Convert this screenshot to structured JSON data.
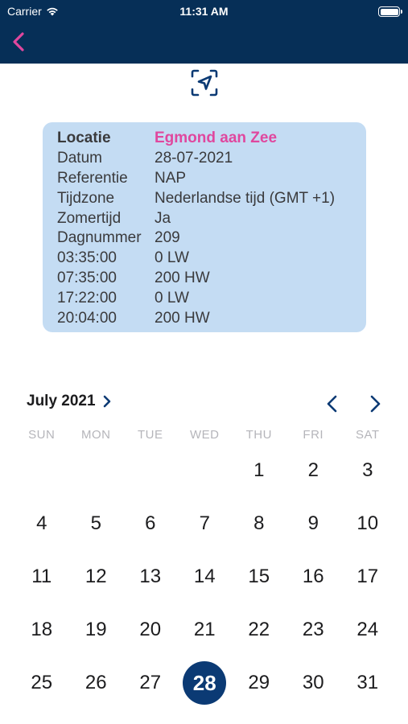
{
  "status": {
    "carrier": "Carrier",
    "time": "11:31 AM"
  },
  "nav": {
    "back_icon": "chevron-left-icon",
    "locate_icon": "location-arrow-icon"
  },
  "colors": {
    "header": "#062f57",
    "card": "#c4dcf3",
    "accent": "#e0479e",
    "selected": "#0b3a74"
  },
  "info": {
    "rows": [
      {
        "k": "Locatie",
        "v": "Egmond aan Zee"
      },
      {
        "k": "Datum",
        "v": "28-07-2021"
      },
      {
        "k": "Referentie",
        "v": "NAP"
      },
      {
        "k": "Tijdzone",
        "v": "Nederlandse tijd (GMT +1)"
      },
      {
        "k": "Zomertijd",
        "v": "Ja"
      },
      {
        "k": "Dagnummer",
        "v": "209"
      },
      {
        "k": "03:35:00",
        "v": "0 LW"
      },
      {
        "k": "07:35:00",
        "v": "200 HW"
      },
      {
        "k": "17:22:00",
        "v": "0 LW"
      },
      {
        "k": "20:04:00",
        "v": "200 HW"
      }
    ]
  },
  "calendar": {
    "title": "July 2021",
    "weekdays": [
      "SUN",
      "MON",
      "TUE",
      "WED",
      "THU",
      "FRI",
      "SAT"
    ],
    "days": [
      "",
      "",
      "",
      "",
      "1",
      "2",
      "3",
      "4",
      "5",
      "6",
      "7",
      "8",
      "9",
      "10",
      "11",
      "12",
      "13",
      "14",
      "15",
      "16",
      "17",
      "18",
      "19",
      "20",
      "21",
      "22",
      "23",
      "24",
      "25",
      "26",
      "27",
      "28",
      "29",
      "30",
      "31"
    ],
    "selected": "28"
  }
}
